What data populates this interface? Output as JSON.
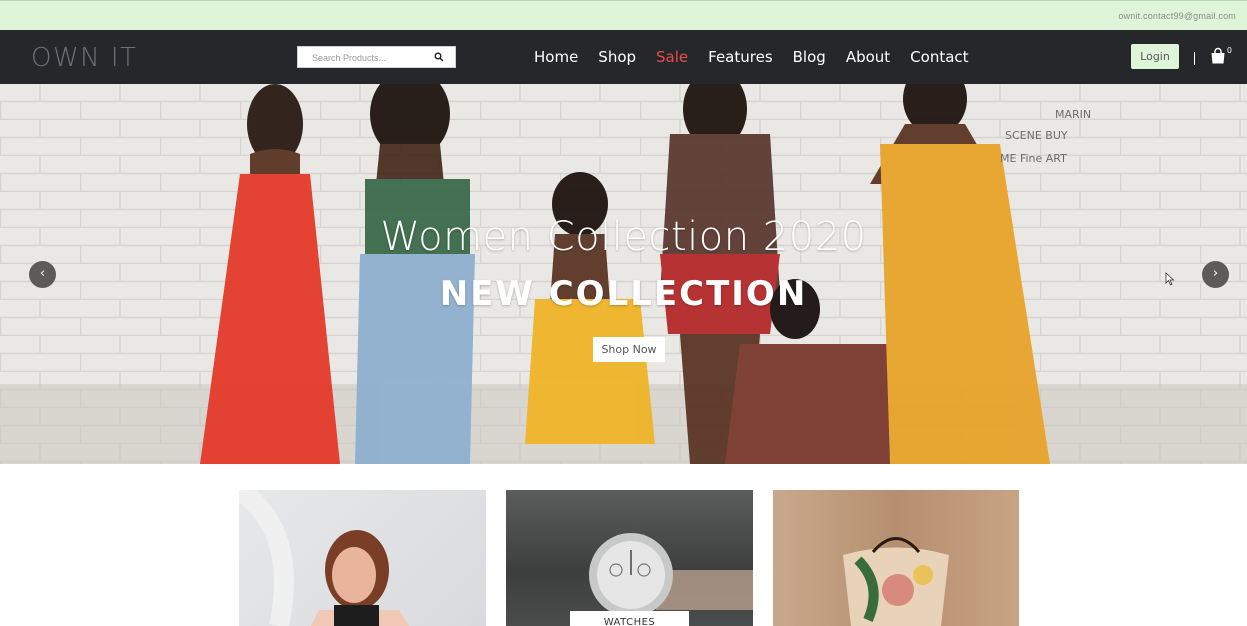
{
  "topbar": {
    "email": "ownit.contact99@gmail.com"
  },
  "header": {
    "logo": "OWN IT",
    "search_placeholder": "Search Products...",
    "menu": [
      {
        "label": "Home",
        "active": false
      },
      {
        "label": "Shop",
        "active": false
      },
      {
        "label": "Sale",
        "active": true
      },
      {
        "label": "Features",
        "active": false
      },
      {
        "label": "Blog",
        "active": false
      },
      {
        "label": "About",
        "active": false
      },
      {
        "label": "Contact",
        "active": false
      }
    ],
    "login_label": "Login",
    "cart_count": "0"
  },
  "hero": {
    "title": "Women Collection 2020",
    "subtitle": "NEW COLLECTION",
    "button_label": "Shop Now",
    "prev_icon": "chevron-left-icon",
    "next_icon": "chevron-right-icon"
  },
  "categories": [
    {
      "label": ""
    },
    {
      "label": "WATCHES"
    },
    {
      "label": ""
    }
  ],
  "colors": {
    "topbar_bg": "#dff5d9",
    "navbar_bg": "#26272b",
    "active_menu": "#e84d4d",
    "login_bg": "#dff5d9"
  }
}
